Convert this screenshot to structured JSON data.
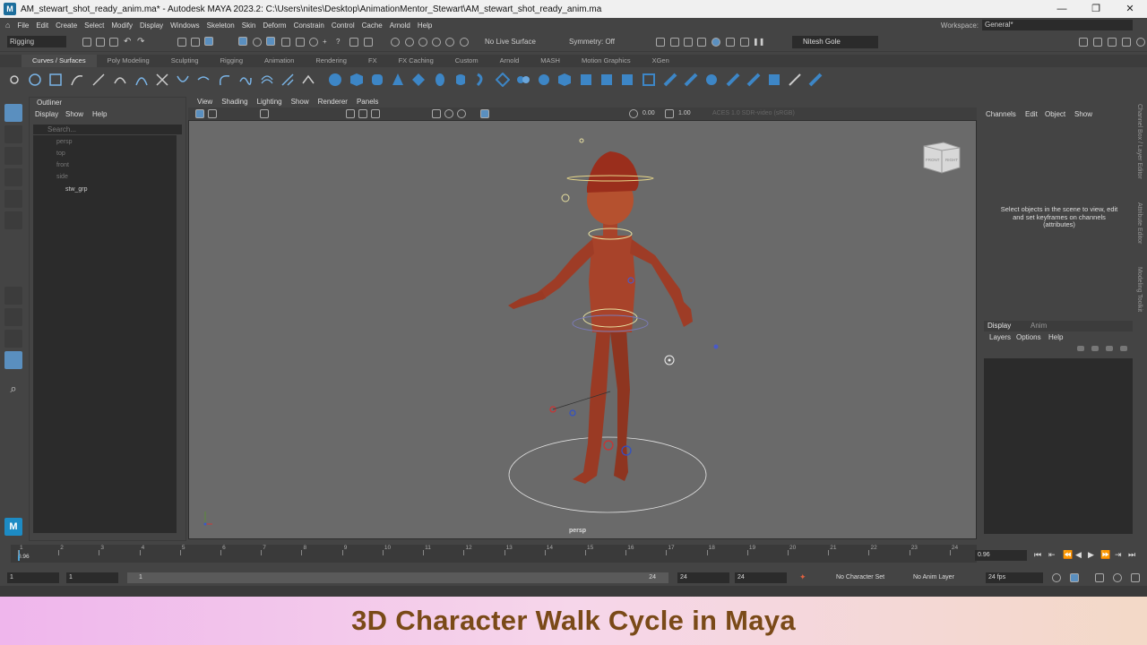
{
  "window": {
    "title": "AM_stewart_shot_ready_anim.ma* - Autodesk MAYA 2023.2: C:\\Users\\nites\\Desktop\\AnimationMentor_Stewart\\AM_stewart_shot_ready_anim.ma",
    "controls": {
      "minimize": "—",
      "maximize": "❐",
      "close": "✕"
    }
  },
  "menubar": {
    "items": [
      "File",
      "Edit",
      "Create",
      "Select",
      "Modify",
      "Display",
      "Windows",
      "Skeleton",
      "Skin",
      "Deform",
      "Constrain",
      "Control",
      "Cache",
      "Arnold",
      "Help"
    ],
    "workspace_label": "Workspace:",
    "workspace_value": "General*"
  },
  "statusline": {
    "menuset": "Rigging",
    "live_surface": "No Live Surface",
    "symmetry": "Symmetry: Off",
    "user": "Nitesh Gole"
  },
  "shelf": {
    "tabs": [
      "Curves / Surfaces",
      "Poly Modeling",
      "Sculpting",
      "Rigging",
      "Animation",
      "Rendering",
      "FX",
      "FX Caching",
      "Custom",
      "Arnold",
      "MASH",
      "Motion Graphics",
      "XGen"
    ],
    "active_tab": "Curves / Surfaces"
  },
  "outliner": {
    "title": "Outliner",
    "menus": [
      "Display",
      "Show",
      "Help"
    ],
    "search_placeholder": "Search...",
    "items": [
      "persp",
      "top",
      "front",
      "side"
    ],
    "group": "stw_grp"
  },
  "viewport": {
    "menus": [
      "View",
      "Shading",
      "Lighting",
      "Show",
      "Renderer",
      "Panels"
    ],
    "exposure": "0.00",
    "gamma": "1.00",
    "colorspace": "ACES 1.0 SDR-video (sRGB)",
    "camera": "persp",
    "viewcube_front": "FRONT",
    "viewcube_right": "RIGHT"
  },
  "channelbox": {
    "menus": [
      "Channels",
      "Edit",
      "Object",
      "Show"
    ],
    "message": "Select objects in the scene to view, edit and set keyframes on channels (attributes)"
  },
  "layers": {
    "tabs": [
      "Display",
      "Anim"
    ],
    "menus": [
      "Layers",
      "Options",
      "Help"
    ]
  },
  "sidetabs": [
    "Channel Box / Layer Editor",
    "Attribute Editor",
    "Modeling Toolkit"
  ],
  "timeslider": {
    "ticks": [
      "1",
      "2",
      "3",
      "4",
      "5",
      "6",
      "7",
      "8",
      "9",
      "10",
      "11",
      "12",
      "13",
      "14",
      "15",
      "16",
      "17",
      "18",
      "19",
      "20",
      "21",
      "22",
      "23",
      "24"
    ],
    "current_frame_label": "0.96",
    "current_frame_field": "0.96"
  },
  "range": {
    "start": "1",
    "playback_start": "1",
    "slider_start": "1",
    "slider_end": "24",
    "playback_end": "24",
    "end": "24",
    "character_set": "No Character Set",
    "anim_layer": "No Anim Layer",
    "fps": "24 fps"
  },
  "banner": {
    "text": "3D Character Walk Cycle in Maya"
  }
}
